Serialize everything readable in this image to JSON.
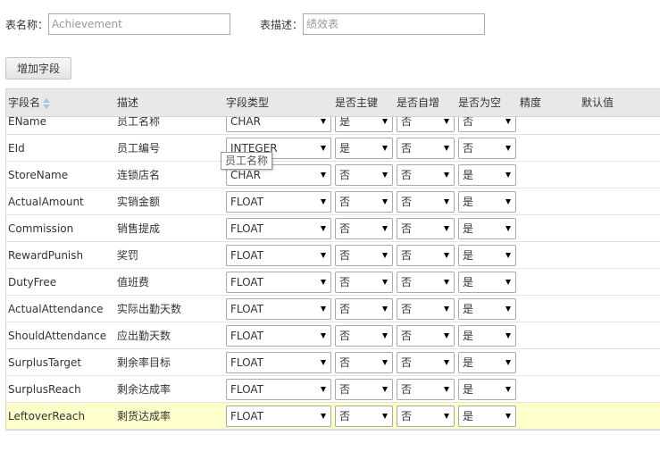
{
  "form": {
    "table_name_label": "表名称：",
    "table_name_placeholder": "Achievement",
    "table_desc_label": "表描述：",
    "table_desc_placeholder": "绩效表"
  },
  "add_field_label": "增加字段",
  "columns": [
    "字段名",
    "描述",
    "字段类型",
    "是否主键",
    "是否自增",
    "是否为空",
    "精度",
    "默认值"
  ],
  "rows": [
    {
      "name": "EName",
      "desc": "员工名称",
      "type": "CHAR",
      "pk": "是",
      "ai": "否",
      "nullable": "否"
    },
    {
      "name": "EId",
      "desc": "员工编号",
      "type": "INTEGER",
      "pk": "是",
      "ai": "否",
      "nullable": "否"
    },
    {
      "name": "StoreName",
      "desc": "连锁店名",
      "type": "CHAR",
      "pk": "否",
      "ai": "否",
      "nullable": "是"
    },
    {
      "name": "ActualAmount",
      "desc": "实销金额",
      "type": "FLOAT",
      "pk": "否",
      "ai": "否",
      "nullable": "是"
    },
    {
      "name": "Commission",
      "desc": "销售提成",
      "type": "FLOAT",
      "pk": "否",
      "ai": "否",
      "nullable": "是"
    },
    {
      "name": "RewardPunish",
      "desc": "奖罚",
      "type": "FLOAT",
      "pk": "否",
      "ai": "否",
      "nullable": "是"
    },
    {
      "name": "DutyFree",
      "desc": "值班费",
      "type": "FLOAT",
      "pk": "否",
      "ai": "否",
      "nullable": "是"
    },
    {
      "name": "ActualAttendance",
      "desc": "实际出勤天数",
      "type": "FLOAT",
      "pk": "否",
      "ai": "否",
      "nullable": "是"
    },
    {
      "name": "ShouldAttendance",
      "desc": "应出勤天数",
      "type": "FLOAT",
      "pk": "否",
      "ai": "否",
      "nullable": "是"
    },
    {
      "name": "SurplusTarget",
      "desc": "剩余率目标",
      "type": "FLOAT",
      "pk": "否",
      "ai": "否",
      "nullable": "是"
    },
    {
      "name": "SurplusReach",
      "desc": "剩余达成率",
      "type": "FLOAT",
      "pk": "否",
      "ai": "否",
      "nullable": "是"
    },
    {
      "name": "LeftoverReach",
      "desc": "剩货达成率",
      "type": "FLOAT",
      "pk": "否",
      "ai": "否",
      "nullable": "是",
      "selected": true
    }
  ],
  "tooltip": "员工名称",
  "colors": {
    "selected_row": "#ffffcc",
    "header_bg": "#e8e8e8",
    "sort_icon": "#a9c2dd"
  }
}
